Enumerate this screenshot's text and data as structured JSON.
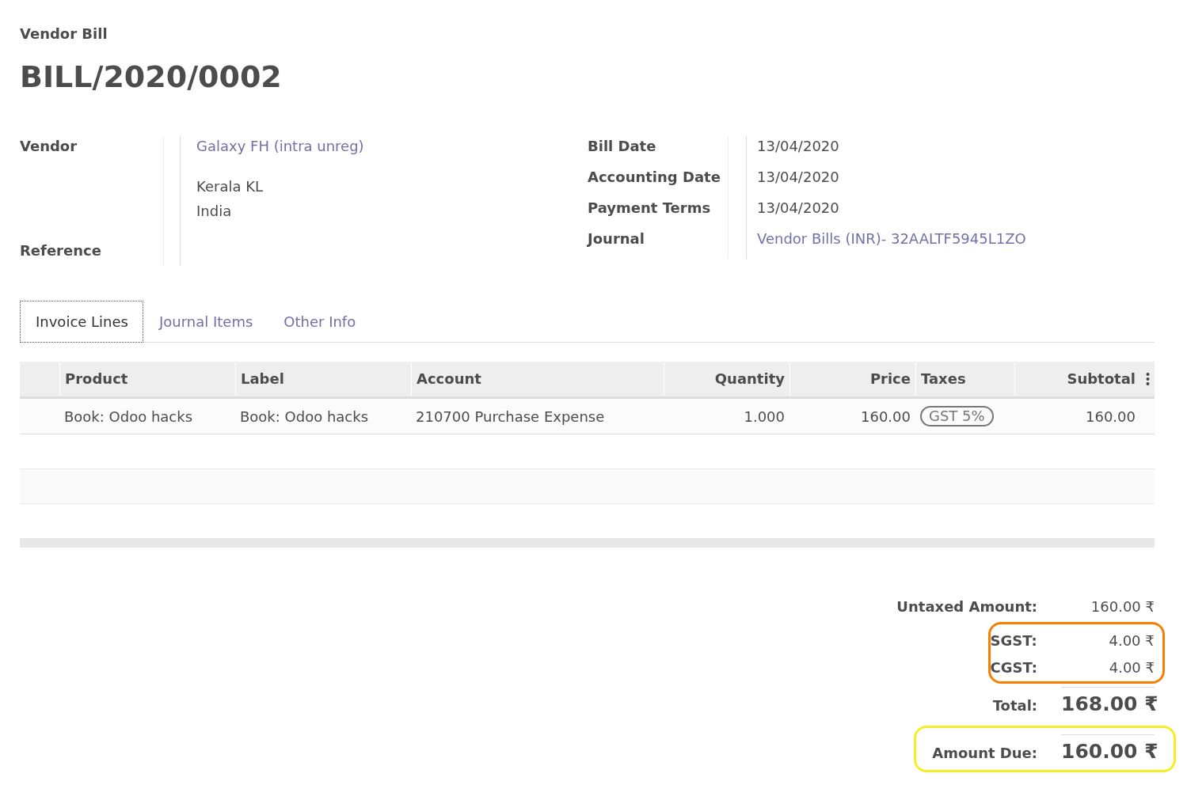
{
  "document_type": "Vendor Bill",
  "number": "BILL/2020/0002",
  "left_fields": [
    {
      "label": "Vendor",
      "value": "Galaxy FH (intra unreg)",
      "link": true,
      "address": [
        "Kerala KL",
        "India"
      ]
    },
    {
      "label": "Reference"
    }
  ],
  "right_fields": [
    {
      "label": "Bill Date",
      "value": "13/04/2020",
      "link": false
    },
    {
      "label": "Accounting Date",
      "value": "13/04/2020",
      "link": false
    },
    {
      "label": "Payment Terms",
      "value": "13/04/2020",
      "link": false
    },
    {
      "label": "Journal",
      "value": "Vendor Bills (INR)- 32AALTF5945L1ZO",
      "link": true
    }
  ],
  "tabs": [
    {
      "label": "Invoice Lines",
      "selected": true
    },
    {
      "label": "Journal Items",
      "selected": false
    },
    {
      "label": "Other Info",
      "selected": false
    }
  ],
  "table": {
    "columns": [
      "Product",
      "Label",
      "Account",
      "Quantity",
      "Price",
      "Taxes",
      "Subtotal"
    ],
    "rows": [
      {
        "product": "Book: Odoo hacks",
        "label": "Book: Odoo hacks",
        "account": "210700 Purchase Expense",
        "quantity": "1.000",
        "price": "160.00",
        "taxes": [
          "GST 5%"
        ],
        "subtotal": "160.00"
      }
    ]
  },
  "totals": {
    "untaxed": {
      "label": "Untaxed Amount:",
      "value": "160.00 ₹"
    },
    "taxes": [
      {
        "label": "SGST:",
        "value": "4.00 ₹"
      },
      {
        "label": "CGST:",
        "value": "4.00 ₹"
      }
    ],
    "total": {
      "label": "Total:",
      "value": "168.00 ₹"
    },
    "amount_due": {
      "label": "Amount Due:",
      "value": "160.00 ₹"
    }
  }
}
